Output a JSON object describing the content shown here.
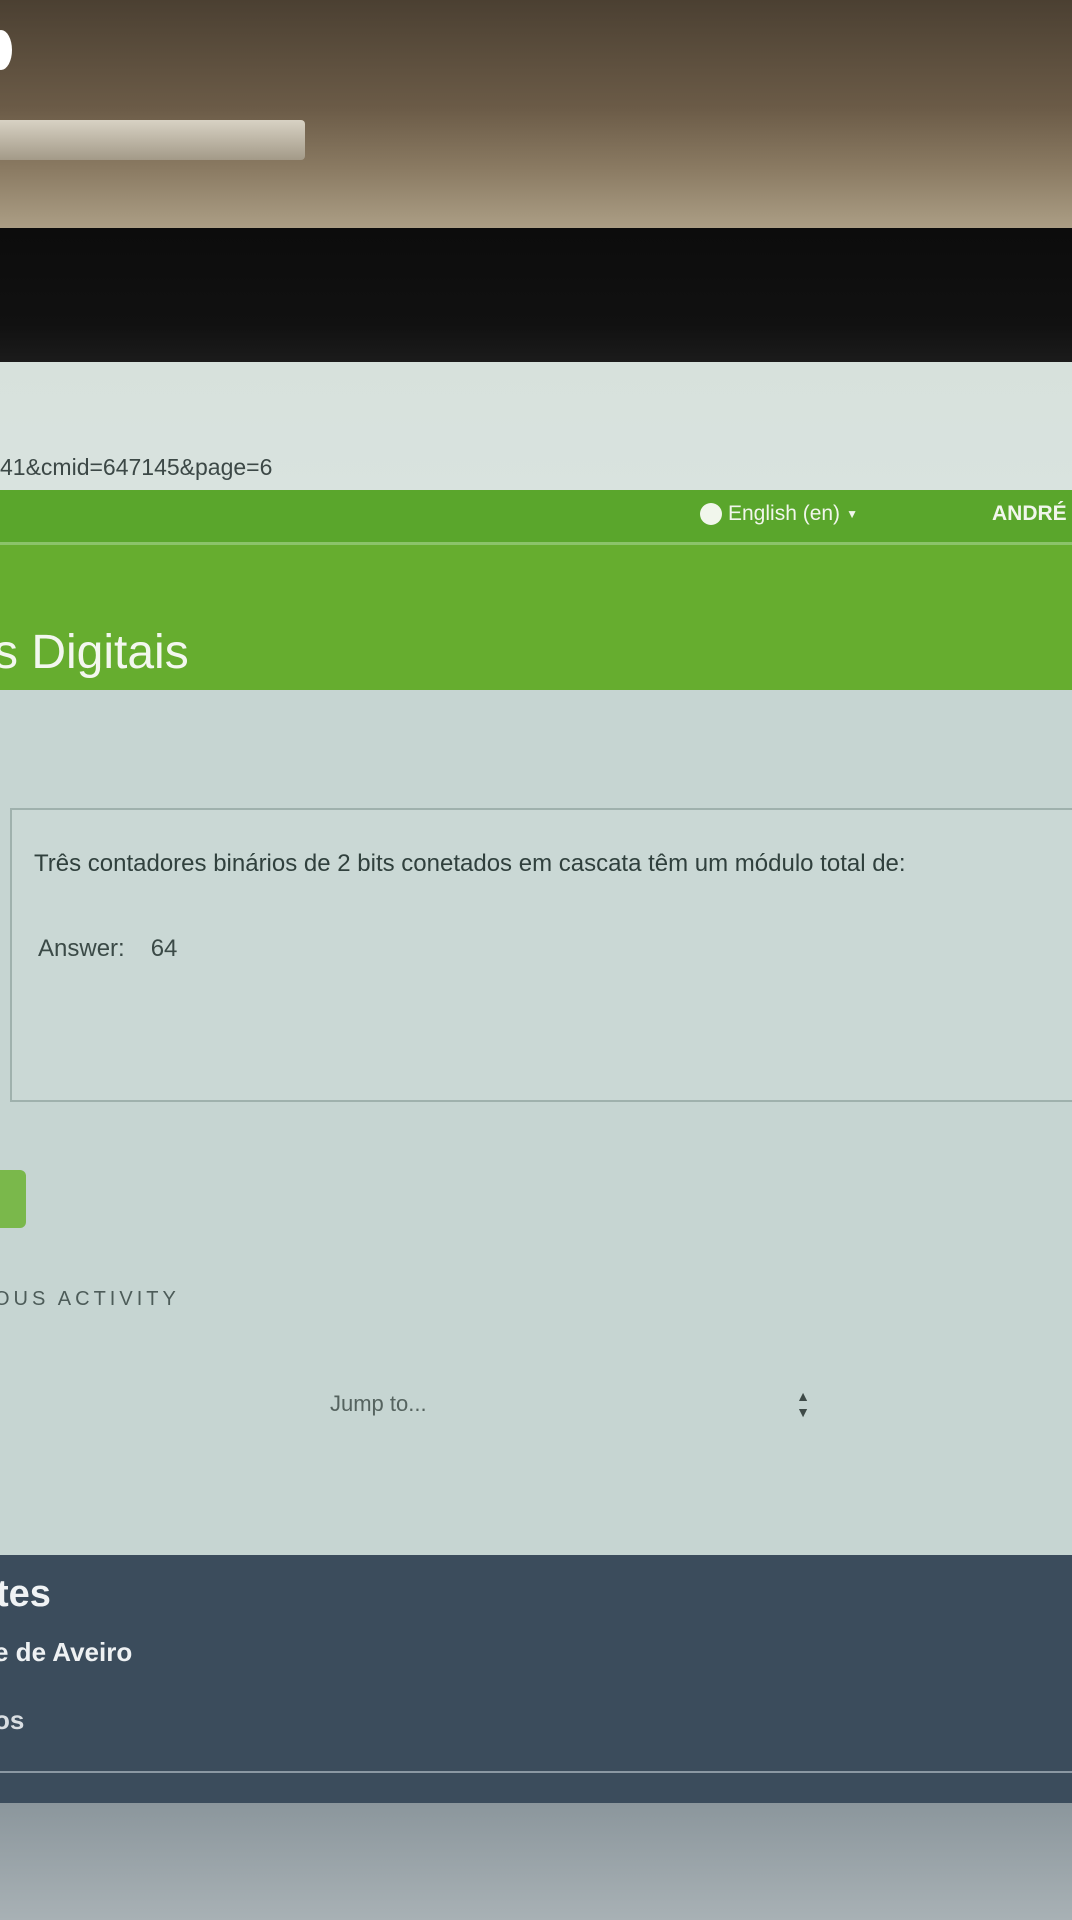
{
  "browser": {
    "url_fragment": "41&cmid=647145&page=6"
  },
  "topnav": {
    "language": "English (en)",
    "user": "ANDRÉ"
  },
  "header": {
    "course_title": "s Digitais"
  },
  "question": {
    "text": "Três contadores binários de 2 bits conetados em cascata têm um módulo total de:",
    "answer_label": "Answer:",
    "answer_value": "64"
  },
  "navigation": {
    "previous_activity": "OUS ACTIVITY",
    "jump_to": "Jump to..."
  },
  "footer": {
    "heading": "tes",
    "link1": "e de Aveiro",
    "link2": "os"
  }
}
